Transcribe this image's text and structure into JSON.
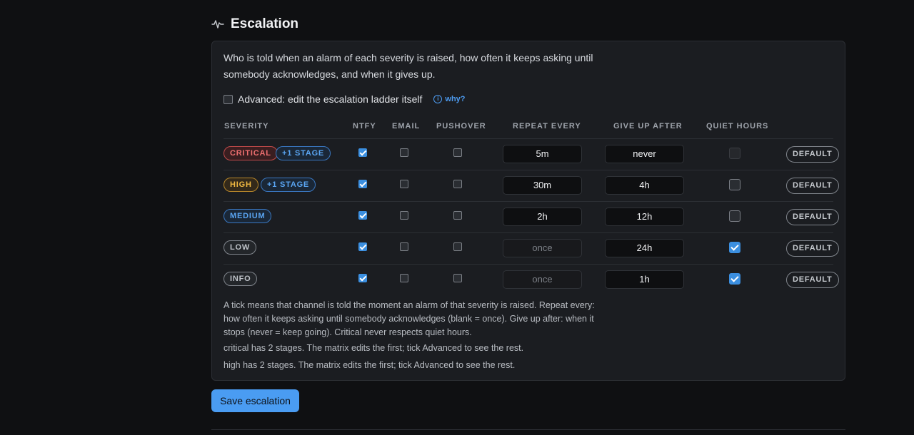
{
  "section": {
    "title": "Escalation",
    "icon": "activity-icon"
  },
  "intro": "Who is told when an alarm of each severity is raised, how often it keeps asking until somebody acknowledges, and when it gives up.",
  "advanced": {
    "label": "Advanced: edit the escalation ladder itself",
    "checked": false,
    "why_label": "why?"
  },
  "columns": {
    "severity": "SEVERITY",
    "ntfy": "NTFY",
    "email": "EMAIL",
    "pushover": "PUSHOVER",
    "repeat": "REPEAT EVERY",
    "giveup": "GIVE UP AFTER",
    "quiet": "QUIET HOURS"
  },
  "rows": [
    {
      "severity": "CRITICAL",
      "stage": "+1 STAGE",
      "ntfy": true,
      "email": false,
      "pushover": false,
      "repeat": "5m",
      "repeat_placeholder": "",
      "giveup": "never",
      "quiet": false,
      "quiet_disabled": true,
      "default_label": "DEFAULT"
    },
    {
      "severity": "HIGH",
      "stage": "+1 STAGE",
      "ntfy": true,
      "email": false,
      "pushover": false,
      "repeat": "30m",
      "repeat_placeholder": "",
      "giveup": "4h",
      "quiet": false,
      "quiet_disabled": false,
      "default_label": "DEFAULT"
    },
    {
      "severity": "MEDIUM",
      "stage": "",
      "ntfy": true,
      "email": false,
      "pushover": false,
      "repeat": "2h",
      "repeat_placeholder": "",
      "giveup": "12h",
      "quiet": false,
      "quiet_disabled": false,
      "default_label": "DEFAULT"
    },
    {
      "severity": "LOW",
      "stage": "",
      "ntfy": true,
      "email": false,
      "pushover": false,
      "repeat": "",
      "repeat_placeholder": "once",
      "giveup": "24h",
      "quiet": true,
      "quiet_disabled": false,
      "default_label": "DEFAULT"
    },
    {
      "severity": "INFO",
      "stage": "",
      "ntfy": true,
      "email": false,
      "pushover": false,
      "repeat": "",
      "repeat_placeholder": "once",
      "giveup": "1h",
      "quiet": true,
      "quiet_disabled": false,
      "default_label": "DEFAULT"
    }
  ],
  "help": "A tick means that channel is told the moment an alarm of that severity is raised. Repeat every: how often it keeps asking until somebody acknowledges (blank = once). Give up after: when it stops (never = keep going). Critical never respects quiet hours.",
  "notes": [
    "critical has 2 stages. The matrix edits the first; tick Advanced to see the rest.",
    "high has 2 stages. The matrix edits the first; tick Advanced to see the rest."
  ],
  "save_label": "Save escalation"
}
